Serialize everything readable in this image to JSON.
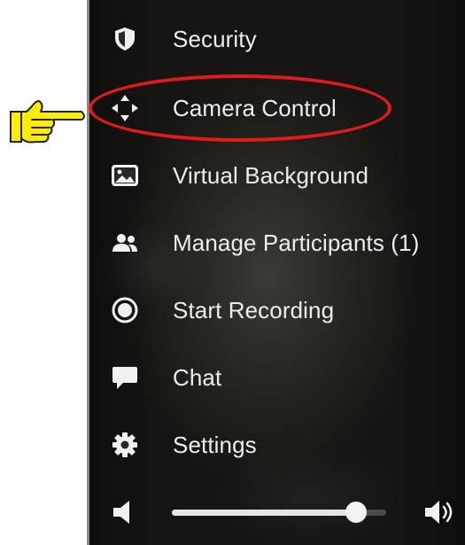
{
  "menu": {
    "items": [
      {
        "label": "Security",
        "icon": "shield-icon"
      },
      {
        "label": "Camera Control",
        "icon": "move-arrows-icon"
      },
      {
        "label": "Virtual Background",
        "icon": "image-icon"
      },
      {
        "label": "Manage Participants (1)",
        "icon": "participants-icon"
      },
      {
        "label": "Start Recording",
        "icon": "record-icon"
      },
      {
        "label": "Chat",
        "icon": "chat-bubble-icon"
      },
      {
        "label": "Settings",
        "icon": "gear-icon"
      }
    ],
    "highlighted_item": "Camera Control"
  },
  "volume": {
    "level": 0.86,
    "low_icon": "volume-low-icon",
    "high_icon": "volume-high-icon"
  },
  "annotation": {
    "pointer_icon": "pointing-hand-icon",
    "ring_color": "#e11b1b",
    "hand_color": "#ffec00"
  },
  "colors": {
    "menu_text": "#ededed",
    "icon": "#f0f0f0"
  }
}
